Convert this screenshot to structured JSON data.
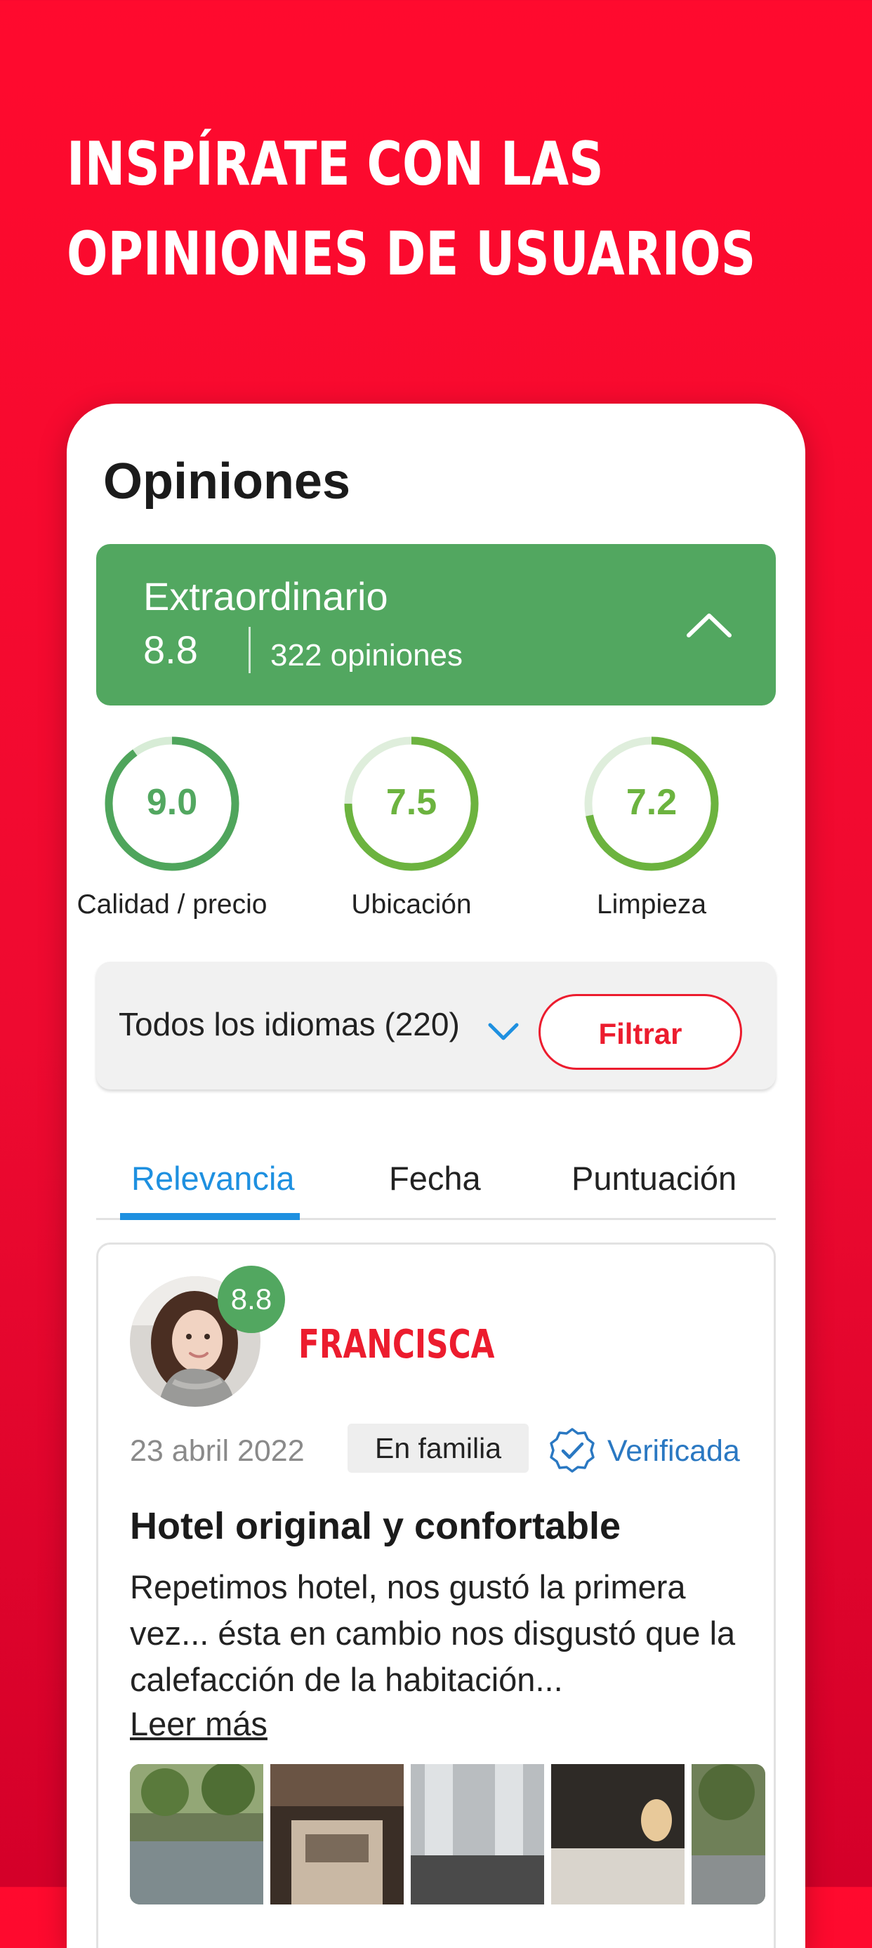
{
  "hero": {
    "line1": "INSPÍRATE CON LAS",
    "line2": "OPINIONES DE USUARIOS"
  },
  "reviews_section": {
    "title": "Opiniones",
    "summary": {
      "label": "Extraordinario",
      "score": "8.8",
      "count": "322 opiniones",
      "toggle_icon": "chevron-up-icon"
    },
    "categories": [
      {
        "value": "9.0",
        "label": "Calidad / precio",
        "score": 9.0
      },
      {
        "value": "7.5",
        "label": "Ubicación",
        "score": 7.5
      },
      {
        "value": "7.2",
        "label": "Limpieza",
        "score": 7.2
      }
    ],
    "language_filter": {
      "value": "Todos los idiomas (220)",
      "icon": "chevron-down-icon"
    },
    "filter_button": "Filtrar",
    "tabs": [
      {
        "label": "Relevancia",
        "active": true
      },
      {
        "label": "Fecha",
        "active": false
      },
      {
        "label": "Puntuación",
        "active": false
      }
    ],
    "review": {
      "score": "8.8",
      "author": "FRANCISCA",
      "date": "23 abril 2022",
      "trip_type": "En familia",
      "verified_label": "Verificada",
      "title": "Hotel original y confortable",
      "body": "Repetimos hotel, nos gustó la primera vez... ésta en cambio nos disgustó que la calefacción de la habitación...",
      "read_more": "Leer más"
    }
  },
  "colors": {
    "brand_red": "#ec1c2e",
    "score_green": "#52a760",
    "ring_green": "#6cb33f",
    "tab_blue": "#1e90e0",
    "verified_blue": "#2a78c2"
  }
}
